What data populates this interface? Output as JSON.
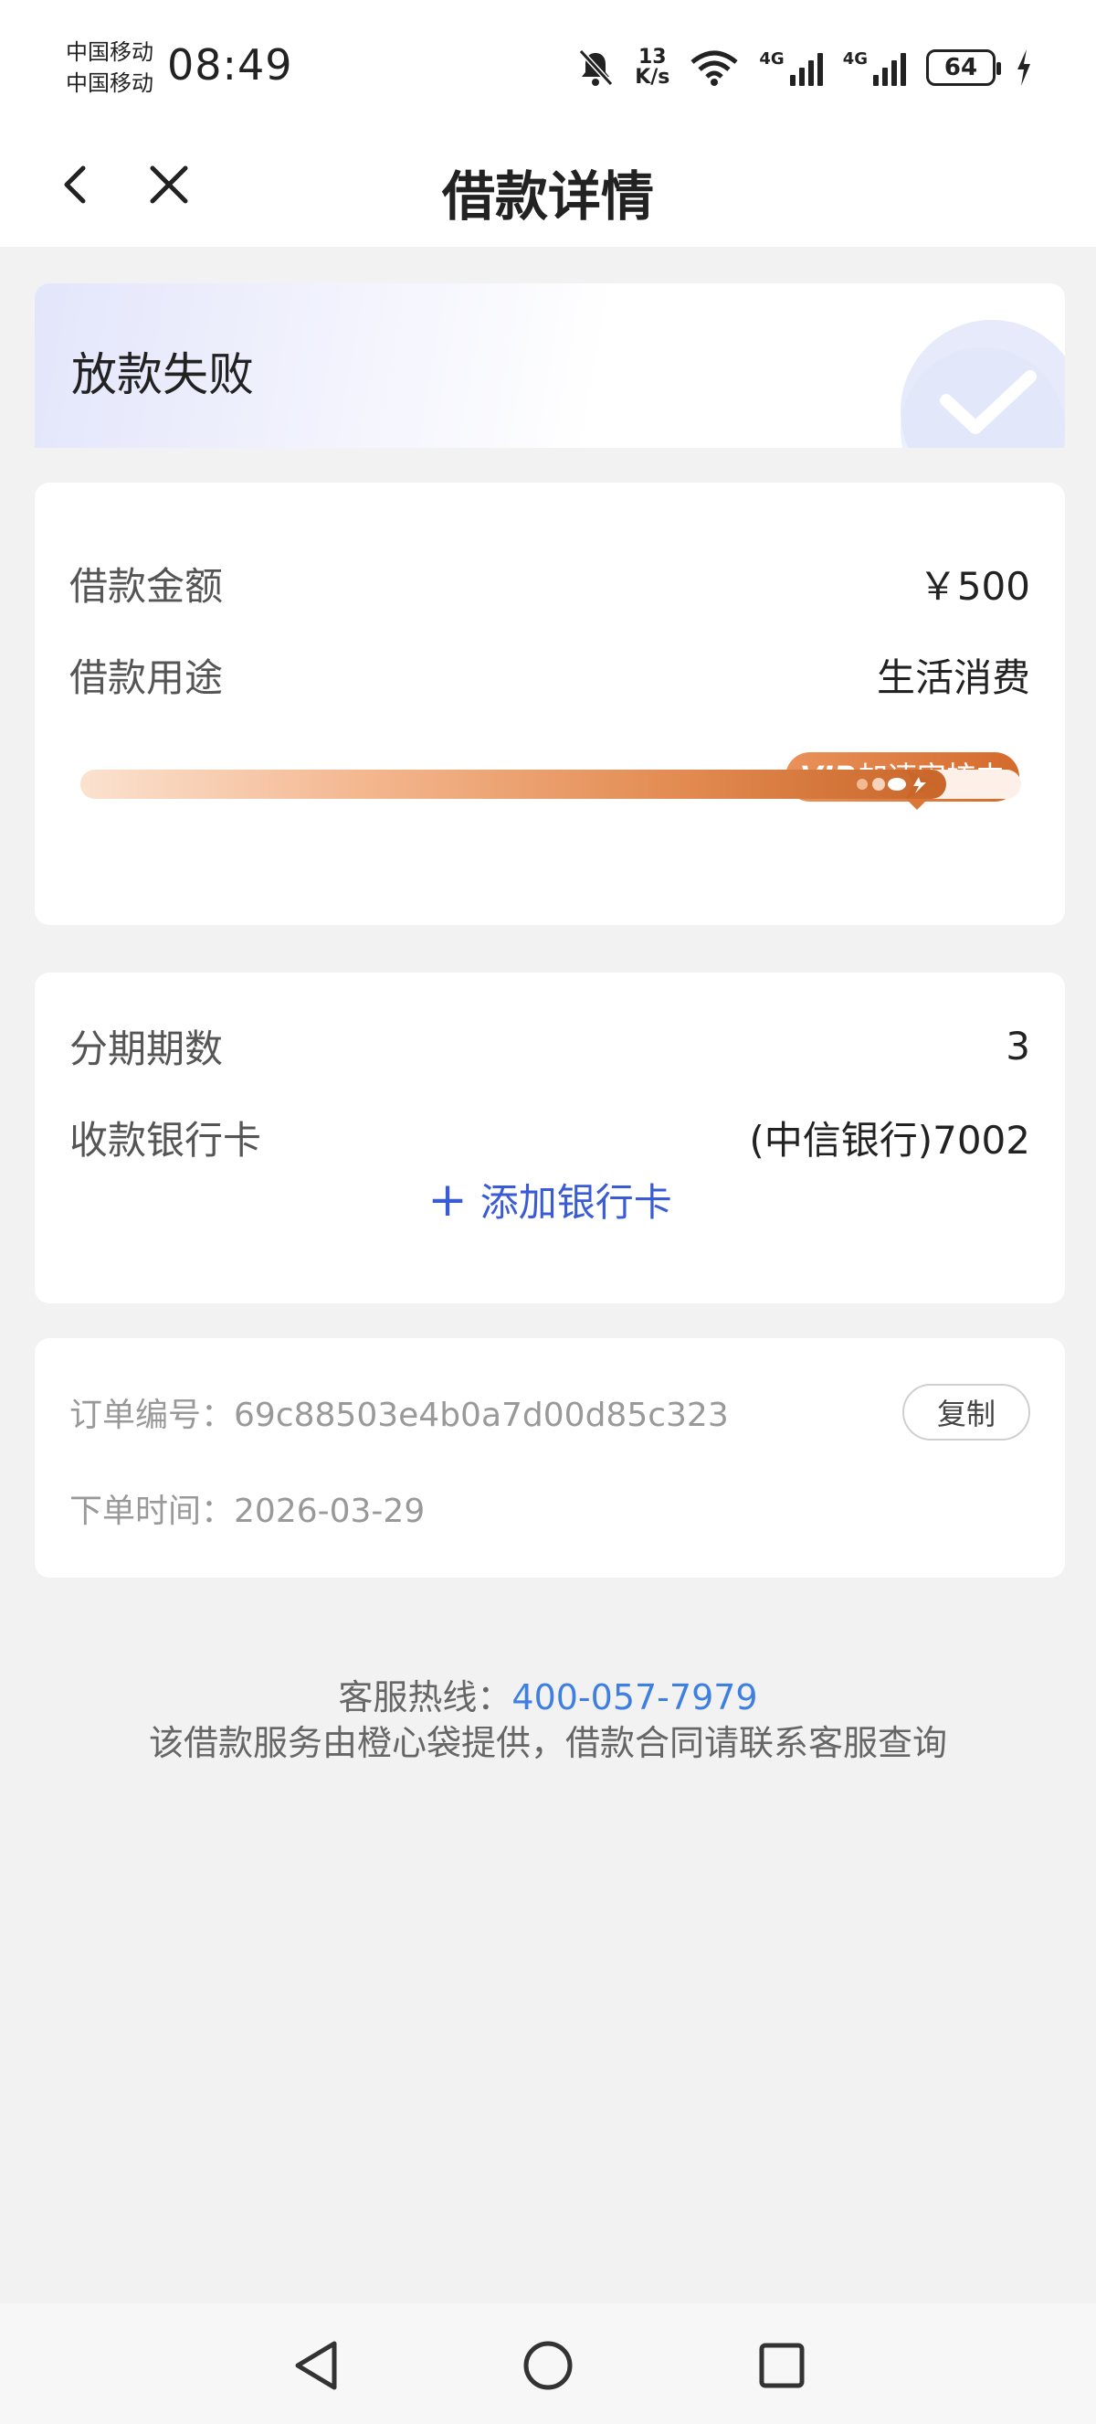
{
  "status_bar": {
    "carrier_top": "中国移动",
    "carrier_bottom": "中国移动",
    "time": "08:49",
    "net_speed_value": "13",
    "net_speed_unit": "K/s",
    "signal1_label": "4G",
    "signal2_label": "4G",
    "battery": "64"
  },
  "header": {
    "title": "借款详情"
  },
  "status_card": {
    "status": "放款失败"
  },
  "loan": {
    "amount_label": "借款金额",
    "amount_value": "￥500",
    "purpose_label": "借款用途",
    "purpose_value": "生活消费",
    "vip_prefix": "VIP",
    "vip_text": "加速审核中",
    "progress": 0.92
  },
  "installment": {
    "periods_label": "分期期数",
    "periods_value": "3",
    "bank_label": "收款银行卡",
    "bank_value": "(中信银行)7002",
    "add_card": "添加银行卡"
  },
  "order": {
    "number_label": "订单编号：",
    "number_value": "69c88503e4b0a7d00d85c323",
    "copy": "复制",
    "time_label": "下单时间：",
    "time_value": "2026-03-29"
  },
  "footer": {
    "hotline_label": "客服热线：",
    "hotline_value": "400-057-7979",
    "notice": "该借款服务由橙心袋提供，借款合同请联系客服查询"
  },
  "icons": {
    "back": "chevron-left-icon",
    "close": "close-icon",
    "mute": "bell-off-icon",
    "wifi": "wifi-icon",
    "charging": "bolt-icon"
  }
}
